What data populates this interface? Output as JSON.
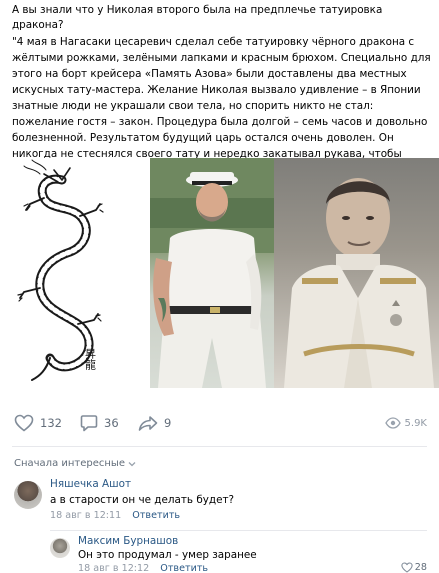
{
  "post": {
    "intro": "А вы знали что у Николая второго была на предплечье татуировка дракона?",
    "quote": "\"4 мая в Нагасаки цесаревич сделал себе татуировку чёрного дракона с жёлтыми рожками, зелёными лапками и красным брюхом. Специально для этого на борт крейсера «Память Азова» были доставлены два местных искусных тату-мастера. Желание Николая вызвало удивление – в Японии знатные люди не украшали свои тела, но спорить никто не стал: пожелание гостя – закон. Процедура была долгой – семь часов и довольно болезненной. Результатом будущий царь остался очень доволен. Он никогда не стеснялся своего тату и нередко закатывал рукава, чтобы только покрасоваться.\"",
    "dragon_caption": "昇龍"
  },
  "actions": {
    "likes": "132",
    "comments": "36",
    "shares": "9",
    "views": "5.9K"
  },
  "comments_sort": "Сначала интересные",
  "comments": [
    {
      "author": "Няшечка Ашот",
      "text": "а в старости он че делать будет?",
      "date": "18 авг в 12:11",
      "reply": "Ответить"
    },
    {
      "author": "Максим Бурнашов",
      "text": "Он это продумал - умер заранее",
      "date": "18 авг в 12:12",
      "reply": "Ответить",
      "likes": "28"
    }
  ],
  "colors": {
    "link": "#2a5885",
    "muted": "#939ba6",
    "action": "#626d7a",
    "divider": "#e7e8ec"
  },
  "icons": [
    "heart-icon",
    "comment-icon",
    "share-icon",
    "eye-icon",
    "chevron-down-icon"
  ]
}
